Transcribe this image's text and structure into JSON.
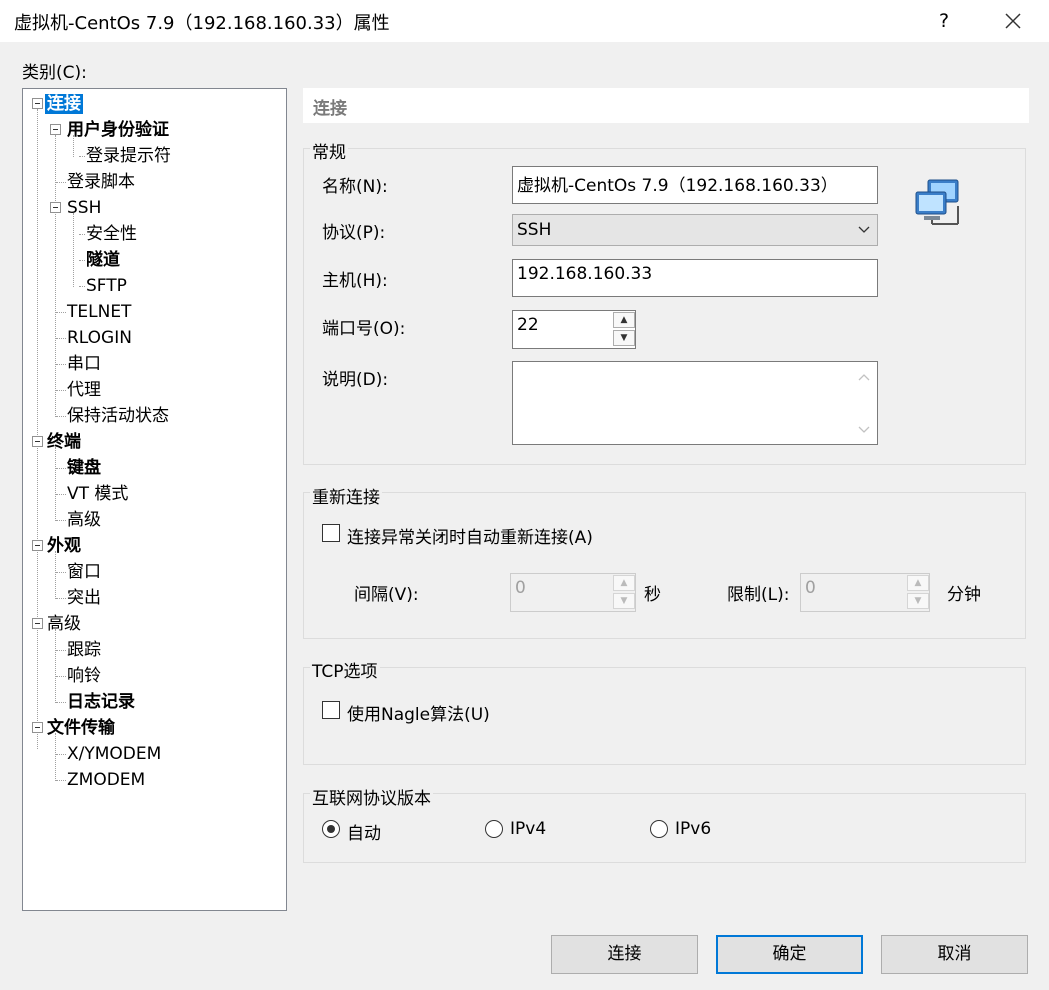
{
  "window": {
    "title": "虚拟机-CentOs 7.9（192.168.160.33）属性",
    "help": "?",
    "close_icon": "close-icon"
  },
  "category_label": "类别(C):",
  "tree": [
    {
      "label": "连接",
      "bold": true,
      "selected": true
    },
    {
      "label": "用户身份验证",
      "bold": true
    },
    {
      "label": "登录提示符"
    },
    {
      "label": "登录脚本"
    },
    {
      "label": "SSH"
    },
    {
      "label": "安全性"
    },
    {
      "label": "隧道",
      "bold": true
    },
    {
      "label": "SFTP"
    },
    {
      "label": "TELNET"
    },
    {
      "label": "RLOGIN"
    },
    {
      "label": "串口"
    },
    {
      "label": "代理"
    },
    {
      "label": "保持活动状态"
    },
    {
      "label": "终端",
      "bold": true
    },
    {
      "label": "键盘",
      "bold": true
    },
    {
      "label": "VT 模式"
    },
    {
      "label": "高级"
    },
    {
      "label": "外观",
      "bold": true
    },
    {
      "label": "窗口"
    },
    {
      "label": "突出"
    },
    {
      "label": "高级"
    },
    {
      "label": "跟踪"
    },
    {
      "label": "响铃"
    },
    {
      "label": "日志记录",
      "bold": true
    },
    {
      "label": "文件传输",
      "bold": true
    },
    {
      "label": "X/YMODEM"
    },
    {
      "label": "ZMODEM"
    }
  ],
  "panel": {
    "header": "连接",
    "general": {
      "title": "常规",
      "name_label": "名称(N):",
      "name_value": "虚拟机-CentOs 7.9（192.168.160.33）",
      "protocol_label": "协议(P):",
      "protocol_value": "SSH",
      "host_label": "主机(H):",
      "host_value": "192.168.160.33",
      "port_label": "端口号(O):",
      "port_value": "22",
      "desc_label": "说明(D):",
      "desc_value": ""
    },
    "reconnect": {
      "title": "重新连接",
      "checkbox_label": "连接异常关闭时自动重新连接(A)",
      "checked": false,
      "interval_label": "间隔(V):",
      "interval_value": "0",
      "interval_unit": "秒",
      "limit_label": "限制(L):",
      "limit_value": "0",
      "limit_unit": "分钟"
    },
    "tcp": {
      "title": "TCP选项",
      "nagle_label": "使用Nagle算法(U)",
      "checked": false
    },
    "ipver": {
      "title": "互联网协议版本",
      "options": [
        "自动",
        "IPv4",
        "IPv6"
      ],
      "selected": "自动"
    }
  },
  "buttons": {
    "connect": "连接",
    "ok": "确定",
    "cancel": "取消"
  }
}
